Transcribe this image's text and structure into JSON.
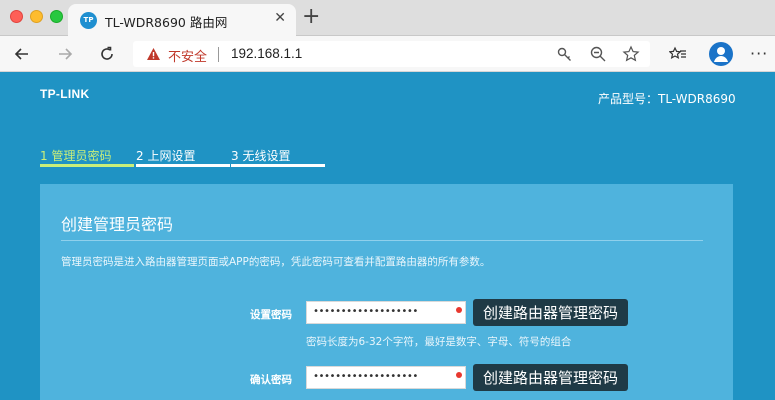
{
  "browser": {
    "tab_favicon": "TP",
    "tab_title": "TL-WDR8690 路由网",
    "close_glyph": "✕",
    "new_tab_glyph": "+",
    "security_label": "不安全",
    "url": "192.168.1.1",
    "more_glyph": "···",
    "icons": [
      "back-icon",
      "forward-icon",
      "refresh-icon",
      "warning-icon",
      "key-icon",
      "zoom-out-icon",
      "star-icon",
      "favorites-icon",
      "profile-icon",
      "more-icon"
    ]
  },
  "router": {
    "logo": "TP-LINK",
    "model_label": "产品型号：TL-WDR8690",
    "steps": [
      {
        "label": "1 管理员密码",
        "active": true
      },
      {
        "label": "2 上网设置",
        "active": false
      },
      {
        "label": "3 无线设置",
        "active": false
      }
    ],
    "panel": {
      "title": "创建管理员密码",
      "description": "管理员密码是进入路由器管理页面或APP的密码，凭此密码可查看并配置路由器的所有参数。",
      "fields": [
        {
          "label": "设置密码",
          "value": "•••••••••••••••••••"
        },
        {
          "label": "确认密码",
          "value": "•••••••••••••••••••"
        }
      ],
      "hint": "密码长度为6-32个字符，最好是数字、字母、符号的组合",
      "callout": "创建路由器管理密码"
    }
  },
  "colors": {
    "page_bg": "#1f93c4",
    "panel_bg": "#4fb3dd",
    "active_step": "#c9ef7a",
    "callout_bg": "#1f3a46",
    "required_dot": "#e8382f",
    "insecure_text": "#c0392b"
  }
}
